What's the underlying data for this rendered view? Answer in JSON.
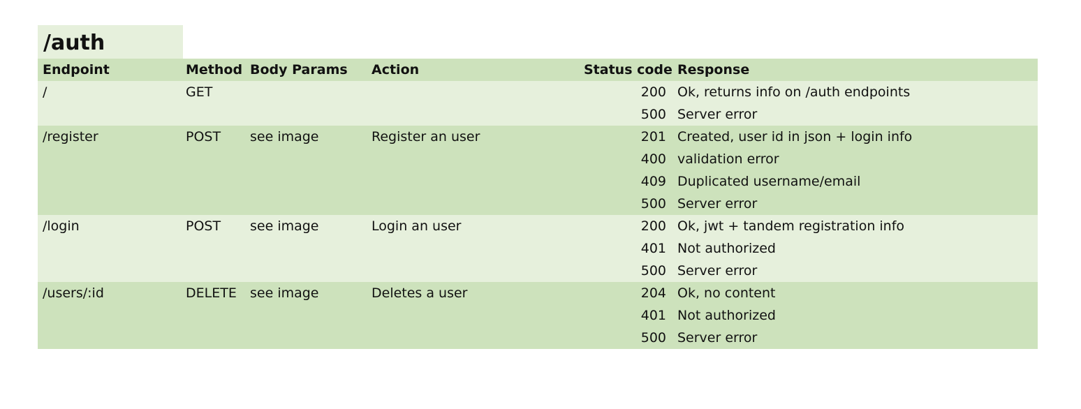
{
  "sheet_title": "/auth",
  "columns": {
    "endpoint": "Endpoint",
    "method": "Method",
    "body_params": "Body Params",
    "action": "Action",
    "status_code": "Status code",
    "response": "Response"
  },
  "groups": [
    {
      "endpoint": "/",
      "method": "GET",
      "body_params": "",
      "action": "",
      "responses": [
        {
          "code": "200",
          "text": "Ok, returns info on /auth endpoints"
        },
        {
          "code": "500",
          "text": "Server error"
        }
      ]
    },
    {
      "endpoint": "/register",
      "method": "POST",
      "body_params": "see image",
      "action": "Register an user",
      "responses": [
        {
          "code": "201",
          "text": "Created, user id in json + login info"
        },
        {
          "code": "400",
          "text": "validation error"
        },
        {
          "code": "409",
          "text": "Duplicated username/email"
        },
        {
          "code": "500",
          "text": "Server error"
        }
      ]
    },
    {
      "endpoint": "/login",
      "method": "POST",
      "body_params": "see image",
      "action": "Login an user",
      "responses": [
        {
          "code": "200",
          "text": "Ok, jwt + tandem registration info"
        },
        {
          "code": "401",
          "text": "Not authorized"
        },
        {
          "code": "500",
          "text": "Server error"
        }
      ]
    },
    {
      "endpoint": "/users/:id",
      "method": "DELETE",
      "body_params": "see image",
      "action": "Deletes a user",
      "responses": [
        {
          "code": "204",
          "text": "Ok, no content"
        },
        {
          "code": "401",
          "text": "Not authorized"
        },
        {
          "code": "500",
          "text": "Server error"
        }
      ]
    }
  ],
  "colors": {
    "light_band": "#e6f0dc",
    "dark_band": "#cde2bc"
  }
}
